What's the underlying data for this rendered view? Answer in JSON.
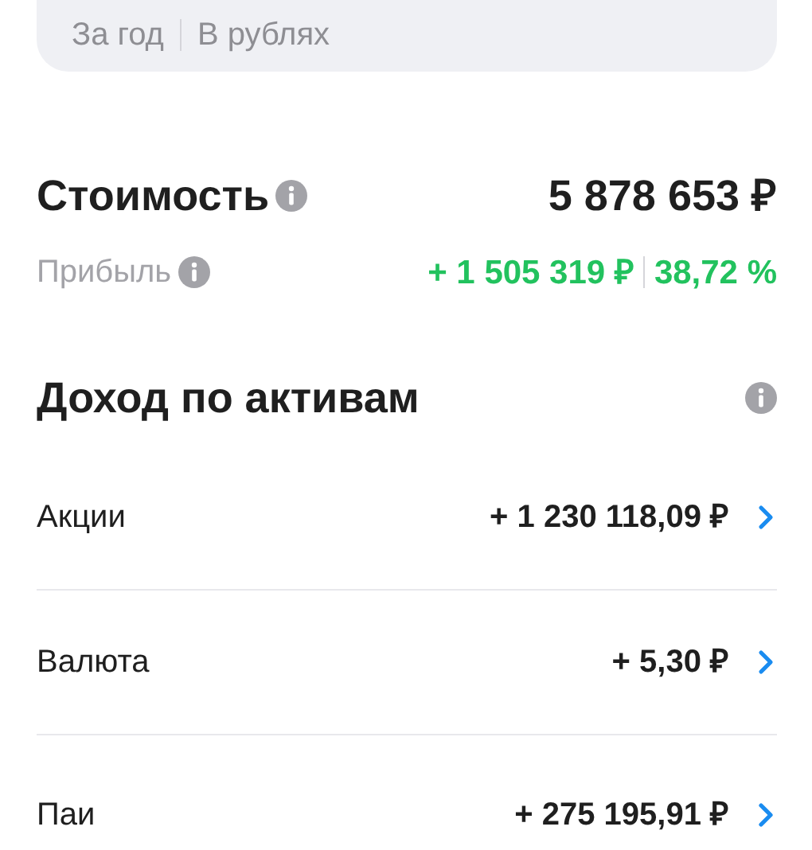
{
  "filter_card": {
    "period": "За год",
    "currency": "В рублях"
  },
  "value": {
    "label": "Стоимость",
    "amount": "5 878 653 ₽"
  },
  "profit": {
    "label": "Прибыль",
    "amount": "+ 1 505 319 ₽",
    "percent": "38,72 %"
  },
  "income": {
    "title": "Доход по активам",
    "rows": [
      {
        "label": "Акции",
        "amount": "+ 1 230 118,09 ₽"
      },
      {
        "label": "Валюта",
        "amount": "+ 5,30 ₽"
      },
      {
        "label": "Паи",
        "amount": "+ 275 195,91 ₽"
      }
    ]
  }
}
